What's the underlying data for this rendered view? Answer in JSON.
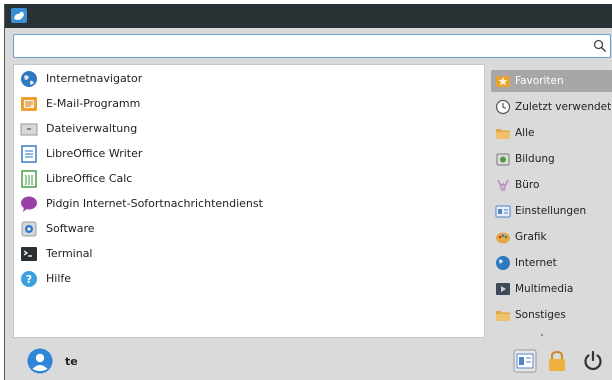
{
  "search": {
    "value": "",
    "placeholder": ""
  },
  "apps": [
    {
      "label": "Internetnavigator",
      "icon": "globe-icon"
    },
    {
      "label": "E-Mail-Programm",
      "icon": "mail-icon"
    },
    {
      "label": "Dateiverwaltung",
      "icon": "file-manager-icon"
    },
    {
      "label": "LibreOffice Writer",
      "icon": "writer-icon"
    },
    {
      "label": "LibreOffice Calc",
      "icon": "calc-icon"
    },
    {
      "label": "Pidgin Internet-Sofortnachrichtendienst",
      "icon": "pidgin-icon"
    },
    {
      "label": "Software",
      "icon": "software-icon"
    },
    {
      "label": "Terminal",
      "icon": "terminal-icon"
    },
    {
      "label": "Hilfe",
      "icon": "help-icon"
    }
  ],
  "categories": [
    {
      "label": "Favoriten",
      "icon": "star-icon",
      "active": true
    },
    {
      "label": "Zuletzt verwendet",
      "icon": "recent-icon"
    },
    {
      "label": "Alle",
      "icon": "folder-icon"
    },
    {
      "label": "Bildung",
      "icon": "education-icon"
    },
    {
      "label": "Büro",
      "icon": "office-icon"
    },
    {
      "label": "Einstellungen",
      "icon": "settings-icon"
    },
    {
      "label": "Grafik",
      "icon": "graphics-icon"
    },
    {
      "label": "Internet",
      "icon": "internet-icon"
    },
    {
      "label": "Multimedia",
      "icon": "multimedia-icon"
    },
    {
      "label": "Sonstiges",
      "icon": "misc-icon"
    }
  ],
  "user": {
    "name": "te"
  },
  "colors": {
    "topbar": "#2a3236",
    "background": "#dadada",
    "accent": "#3b8fd6",
    "active_category": "#a7a7a7"
  }
}
